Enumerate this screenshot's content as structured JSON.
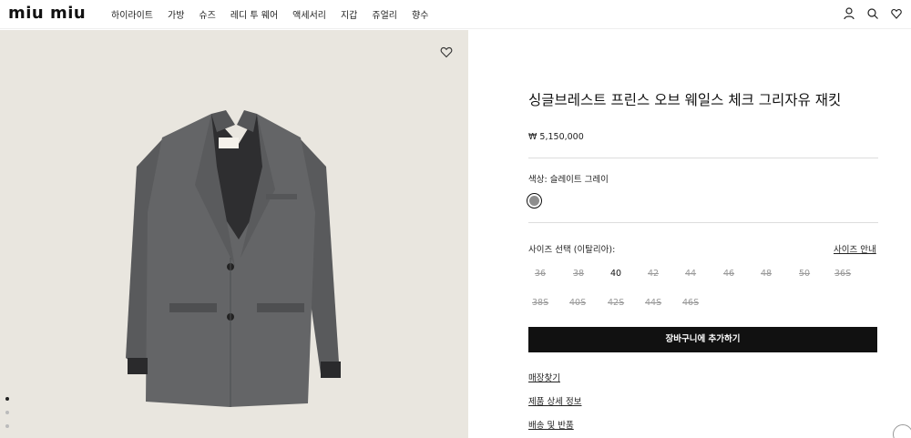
{
  "header": {
    "logo": "miu miu",
    "nav": [
      "하이라이트",
      "가방",
      "슈즈",
      "레디 투 웨어",
      "액세서리",
      "지갑",
      "쥬얼리",
      "향수"
    ],
    "icons": [
      "user-icon",
      "search-icon",
      "heart-icon"
    ]
  },
  "product": {
    "title": "싱글브레스트 프린스 오브 웨일스 체크 그리자유 재킷",
    "price": "₩ 5,150,000",
    "label_tag": "MIU MIU",
    "color_label": "색상:  슬레이트 그레이",
    "swatch_color": "#8e8e8e",
    "size_label": "사이즈 선택 (이탈리아):",
    "size_guide": "사이즈 안내",
    "sizes": [
      {
        "label": "36",
        "available": false
      },
      {
        "label": "38",
        "available": false
      },
      {
        "label": "40",
        "available": true
      },
      {
        "label": "42",
        "available": false
      },
      {
        "label": "44",
        "available": false
      },
      {
        "label": "46",
        "available": false
      },
      {
        "label": "48",
        "available": false
      },
      {
        "label": "50",
        "available": false
      },
      {
        "label": "36S",
        "available": false
      },
      {
        "label": "38S",
        "available": false
      },
      {
        "label": "40S",
        "available": false
      },
      {
        "label": "42S",
        "available": false
      },
      {
        "label": "44S",
        "available": false
      },
      {
        "label": "46S",
        "available": false
      }
    ],
    "add_to_cart": "장바구니에 추가하기",
    "links": [
      "매장찾기",
      "제품 상세 정보",
      "배송 및 반품"
    ]
  },
  "carousel": {
    "dots": 3,
    "active": 0
  },
  "colors": {
    "image_bg": "#e9e6df",
    "button_bg": "#111111"
  }
}
